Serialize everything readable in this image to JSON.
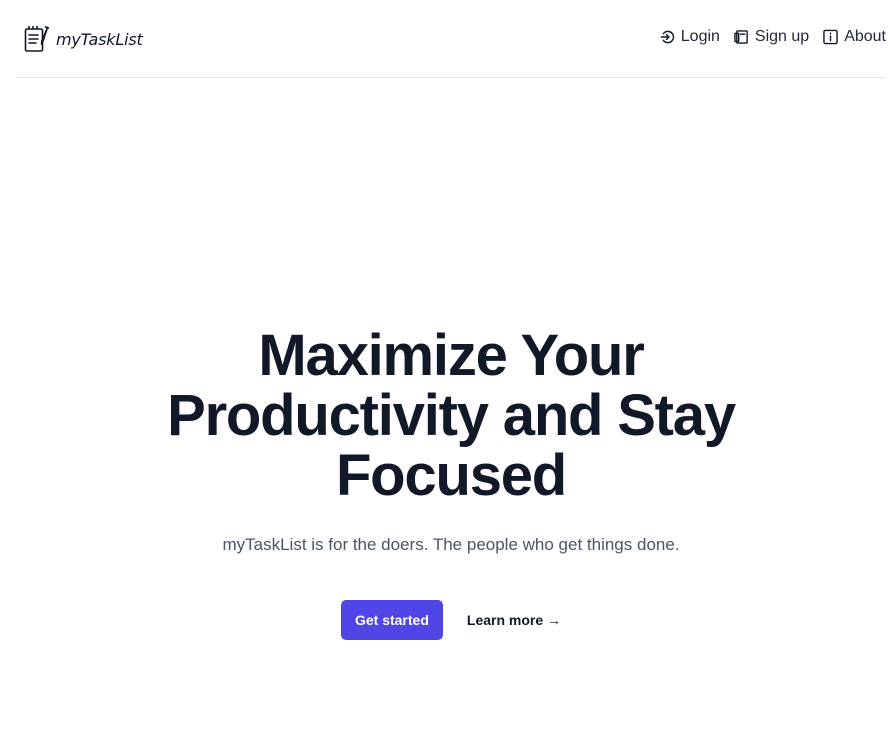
{
  "header": {
    "brand": {
      "name": "myTaskList",
      "icon": "notepad-pen-icon"
    },
    "nav": [
      {
        "label": "Login",
        "icon": "login-icon"
      },
      {
        "label": "Sign up",
        "icon": "signup-icon"
      },
      {
        "label": "About",
        "icon": "info-icon"
      }
    ]
  },
  "hero": {
    "title": "Maximize Your Productivity and Stay Focused",
    "subtitle": "myTaskList is for the doers. The people who get things done.",
    "primary_cta": "Get started",
    "secondary_cta": "Learn more →"
  },
  "colors": {
    "accent": "#4f46e5",
    "text": "#111827",
    "muted": "#4b5563",
    "divider": "#e5e7eb"
  }
}
